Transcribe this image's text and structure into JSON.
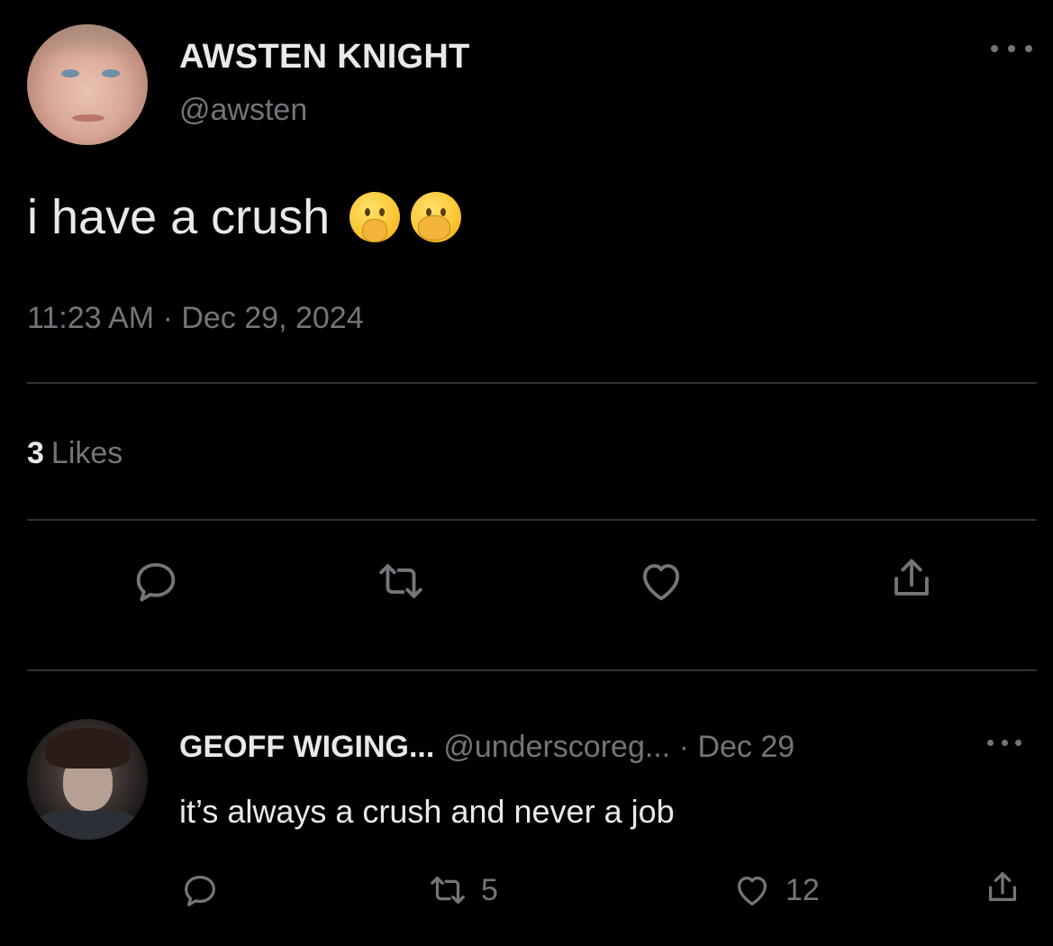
{
  "tweet": {
    "display_name": "AWSTEN KNIGHT",
    "handle": "@awsten",
    "text": "i have a crush",
    "emojis": [
      "shushing-face-emoji",
      "face-with-hand-over-mouth-emoji"
    ],
    "timestamp": "11:23 AM · Dec 29, 2024",
    "likes_count": "3",
    "likes_label": "Likes",
    "actions": [
      "reply-icon",
      "retweet-icon",
      "like-icon",
      "share-icon"
    ]
  },
  "reply": {
    "display_name": "GEOFF WIGING...",
    "handle": "@underscoreg...",
    "separator": "·",
    "date": "Dec 29",
    "text": "it’s always a crush and never a job",
    "retweet_count": "5",
    "like_count": "12"
  },
  "colors": {
    "background": "#000000",
    "primary_text": "#e7e9ea",
    "secondary_text": "#71767b",
    "divider": "#2f3336"
  }
}
